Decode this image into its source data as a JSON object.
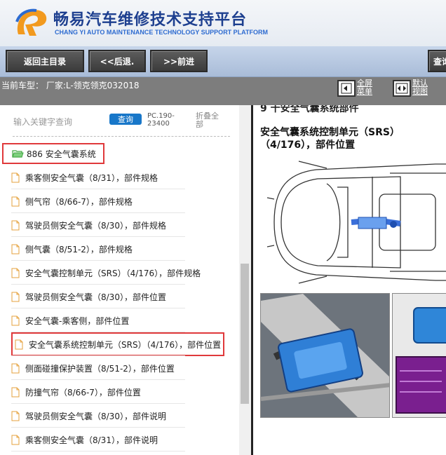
{
  "header": {
    "title": "畅易汽车维修技术支持平台",
    "subtitle": "CHANG YI AUTO MAINTENANCE TECHNOLOGY SUPPORT PLATFORM"
  },
  "toolbar": {
    "back_main": "返回主目录",
    "back": "<<后退.",
    "forward": ">>前进",
    "query": "查询"
  },
  "info": {
    "car_model": "当前车型： 厂家:L-领克领克032018",
    "fullscreen_label": "全屏菜单",
    "default_label": "默认视图"
  },
  "left": {
    "search_placeholder": "输入关键字查询",
    "search_btn": "查询",
    "pc_info": "PC.190-23400",
    "collapse": "折叠全部",
    "root": "886 安全气囊系统",
    "items": [
      "乘客侧安全气囊（8/31），部件规格",
      "侧气帘（8/66-7），部件规格",
      "驾驶员侧安全气囊（8/30），部件规格",
      "侧气囊（8/51-2），部件规格",
      "安全气囊控制单元（SRS）（4/176），部件规格",
      "驾驶员侧安全气囊（8/30），部件位置",
      "安全气囊-乘客侧，部件位置",
      "安全气囊系统控制单元（SRS）（4/176），部件位置",
      "侧面碰撞保护装置（8/51-2），部件位置",
      "防撞气帘（8/66-7），部件位置",
      "驾驶员侧安全气囊（8/30），部件说明",
      "乘客侧安全气囊（8/31），部件说明"
    ]
  },
  "right": {
    "section_head": "9 十安全气囊系统部件",
    "doc_title": "安全气囊系统控制单元（SRS）（4/176），部件位置"
  },
  "colors": {
    "highlight": "#e0393b",
    "brand": "#1d3f8f",
    "search": "#1877c9"
  }
}
